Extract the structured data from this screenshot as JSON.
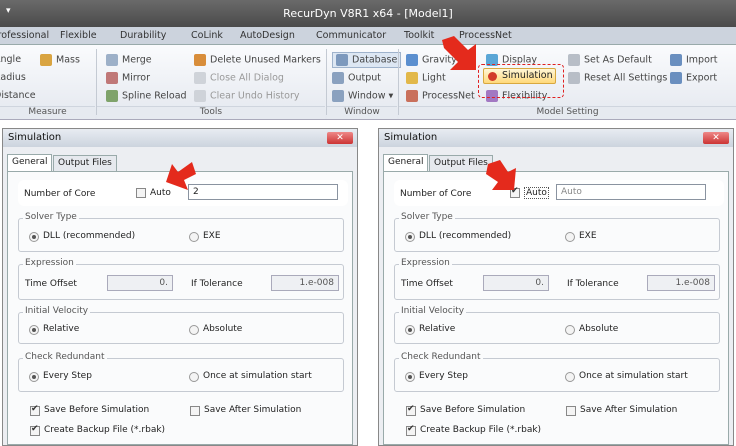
{
  "window": {
    "title": "RecurDyn V8R1 x64 - [Model1]",
    "system_menu": "▾"
  },
  "menu": [
    "Professional",
    "Flexible",
    "Durability",
    "CoLink",
    "AutoDesign",
    "Communicator",
    "Toolkit",
    "ProcessNet"
  ],
  "ribbon": {
    "measure": {
      "items": [
        "Angle",
        "Radius",
        "Distance",
        "Mass"
      ],
      "label": "Measure"
    },
    "tools": {
      "items": [
        "Merge",
        "Mirror",
        "Spline Reload",
        "Delete Unused Markers",
        "Close All Dialog",
        "Clear Undo History"
      ],
      "label": "Tools"
    },
    "window": {
      "items": [
        "Database",
        "Output",
        "Window ▾"
      ],
      "label": "Window"
    },
    "model_setting": {
      "items": [
        "Gravity",
        "Light",
        "ProcessNet",
        "Display",
        "Simulation",
        "Flexibility",
        "Set As Default",
        "Reset All Settings",
        "Import",
        "Export"
      ],
      "label": "Model Setting"
    }
  },
  "dialogs": [
    {
      "title": "Simulation",
      "close": "✕",
      "tabs": [
        "General",
        "Output Files"
      ],
      "core_label": "Number of Core",
      "auto_label": "Auto",
      "auto_checked": false,
      "core_value": "2",
      "solver_type": "Solver Type",
      "dll": "DLL (recommended)",
      "exe": "EXE",
      "expression": "Expression",
      "time_offset": "Time Offset",
      "time_offset_value": "0.",
      "if_tol": "If Tolerance",
      "if_tol_value": "1.e-008",
      "initial_velocity": "Initial Velocity",
      "relative": "Relative",
      "absolute": "Absolute",
      "check_redundant": "Check Redundant",
      "every_step": "Every Step",
      "once": "Once at simulation start",
      "save_before": "Save Before Simulation",
      "save_after": "Save After Simulation",
      "backup": "Create Backup File (*.rbak)"
    },
    {
      "title": "Simulation",
      "close": "✕",
      "tabs": [
        "General",
        "Output Files"
      ],
      "core_label": "Number of Core",
      "auto_label": "Auto",
      "auto_checked": true,
      "core_value": "Auto",
      "solver_type": "Solver Type",
      "dll": "DLL (recommended)",
      "exe": "EXE",
      "expression": "Expression",
      "time_offset": "Time Offset",
      "time_offset_value": "0.",
      "if_tol": "If Tolerance",
      "if_tol_value": "1.e-008",
      "initial_velocity": "Initial Velocity",
      "relative": "Relative",
      "absolute": "Absolute",
      "check_redundant": "Check Redundant",
      "every_step": "Every Step",
      "once": "Once at simulation start",
      "save_before": "Save Before Simulation",
      "save_after": "Save After Simulation",
      "backup": "Create Backup File (*.rbak)"
    }
  ]
}
